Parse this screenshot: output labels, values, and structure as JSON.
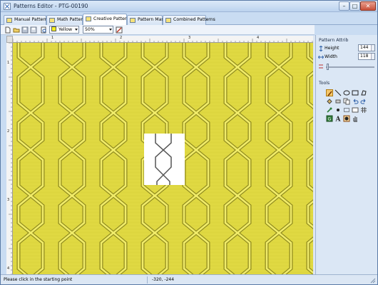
{
  "window": {
    "title": "Patterns Editor - PTG-00190"
  },
  "tabs": [
    {
      "label": "Manual Patterns",
      "active": false
    },
    {
      "label": "Math Patterns",
      "active": false
    },
    {
      "label": "Creative Patterns",
      "active": true
    },
    {
      "label": "Pattern Masks",
      "active": false
    },
    {
      "label": "Combined Patterns",
      "active": false
    }
  ],
  "toolbar": {
    "color_value": "Yellow",
    "zoom_value": "50%",
    "icons": [
      "new-icon",
      "open-icon",
      "save-icon",
      "save-as-icon",
      "print-preview-icon",
      "properties-icon",
      "color-picker-icon"
    ]
  },
  "ruler": {
    "h_labels": [
      "1",
      "2",
      "3",
      "4"
    ],
    "v_labels": [
      "1",
      "2",
      "3",
      "4"
    ]
  },
  "colors": {
    "pattern": "#d9d23a",
    "pattern_dark": "#9c9622",
    "pattern_light": "#f3ee6e",
    "selection": "#ffffff"
  },
  "side": {
    "attrib_title": "Pattern Attrib",
    "height_label": "Height",
    "height_value": "144",
    "width_label": "Width",
    "width_value": "118",
    "tools_title": "Tools",
    "tools": [
      "pencil-tool-icon",
      "line-tool-icon",
      "ellipse-tool-icon",
      "rectangle-tool-icon",
      "polygon-tool-icon",
      "fill-tool-icon",
      "eraser-tool-icon",
      "copy-tool-icon",
      "undo-icon",
      "redo-icon",
      "eyedropper-icon",
      "brush-size-icon",
      "select-rect-icon",
      "pan-icon",
      "grid-icon",
      "text-tool-icon",
      "stamp-icon",
      "hand-icon"
    ]
  },
  "status": {
    "message": "Please click in the starting point",
    "coords": "-320, -244"
  }
}
